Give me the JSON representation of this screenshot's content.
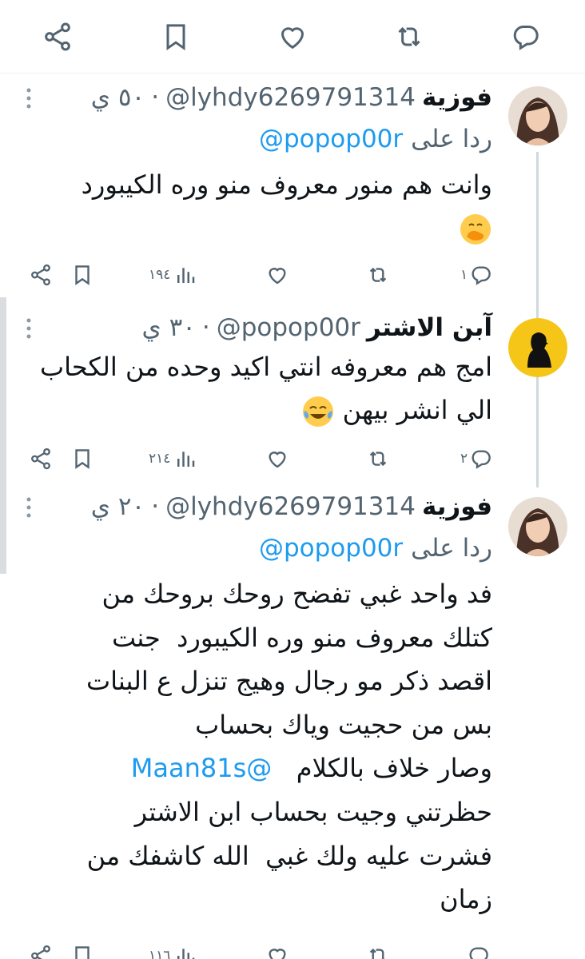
{
  "colors": {
    "link": "#1d9bf0",
    "secondary": "#536471",
    "thread_line": "#cfd9de"
  },
  "top_actions": [
    "share-icon",
    "bookmark-icon",
    "like-icon",
    "retweet-icon",
    "reply-icon"
  ],
  "tweets": [
    {
      "name": "فوزية",
      "handle": "@lyhdy6269791314",
      "separator": "·",
      "time": "٥٠ ي",
      "reply_prefix": "ردا على",
      "reply_to": "@popop00r",
      "body": "وانت هم منور معروف منو وره الكيبورد",
      "emoji": "hand-over-mouth-emoji",
      "counts": {
        "reply": "١",
        "retweet": "",
        "like": "",
        "views": "١٩٤"
      }
    },
    {
      "name": "آبن الاشتر",
      "handle": "@popop00r",
      "separator": "·",
      "time": "٣٠ ي",
      "body": "امج هم معروفه انتي اكيد وحده من الكحاب الي انشر بيهن",
      "emoji": "tears-of-joy-emoji",
      "counts": {
        "reply": "٢",
        "retweet": "",
        "like": "",
        "views": "٢١٤"
      }
    },
    {
      "name": "فوزية",
      "handle": "@lyhdy6269791314",
      "separator": "·",
      "time": "٢٠ ي",
      "reply_prefix": "ردا على",
      "reply_to": "@popop00r",
      "body_lines": [
        "فد واحد غبي تفضح روحك بروحك من",
        "كتلك معروف منو وره الكيبورد  جنت",
        "اقصد ذكر مو رجال وهيج تنزل ع البنات",
        "بس من حجيت وياك بحساب",
        "وصار خلاف بالكلام",
        "حظرتني وجيت بحساب ابن الاشتر",
        "فشرت عليه ولك غبي  الله كاشفك من",
        "زمان"
      ],
      "inline_mention": "@Maan81s",
      "counts": {
        "reply": "",
        "retweet": "",
        "like": "",
        "views": "١١٦"
      }
    }
  ]
}
